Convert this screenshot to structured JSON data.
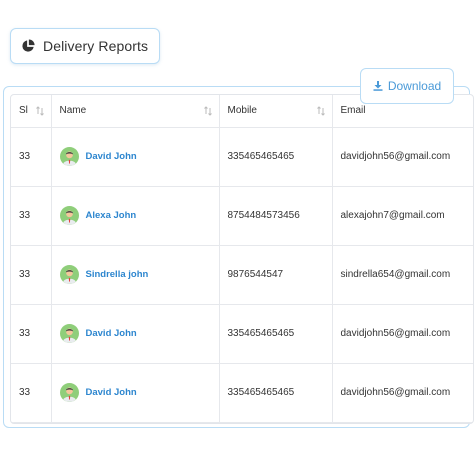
{
  "header": {
    "title": "Delivery Reports"
  },
  "toolbar": {
    "download_label": "Download"
  },
  "table": {
    "columns": [
      "Sl",
      "Name",
      "Mobile",
      "Email"
    ],
    "rows": [
      {
        "sl": "33",
        "name": "David John",
        "mobile": "335465465465",
        "email": "davidjohn56@gmail.com"
      },
      {
        "sl": "33",
        "name": "Alexa John",
        "mobile": "8754484573456",
        "email": "alexajohn7@gmail.com"
      },
      {
        "sl": "33",
        "name": "Sindrella john",
        "mobile": "9876544547",
        "email": "sindrella654@gmail.com"
      },
      {
        "sl": "33",
        "name": "David John",
        "mobile": "335465465465",
        "email": "davidjohn56@gmail.com"
      },
      {
        "sl": "33",
        "name": "David John",
        "mobile": "335465465465",
        "email": "davidjohn56@gmail.com"
      }
    ]
  },
  "colors": {
    "accent": "#2d86cf",
    "border": "#b9dcf5",
    "avatar_bg": "#8fce7a"
  },
  "icons": {
    "title": "pie-chart-icon",
    "download": "download-icon",
    "sort": "sort-arrows-icon",
    "avatar": "user-avatar-icon"
  }
}
